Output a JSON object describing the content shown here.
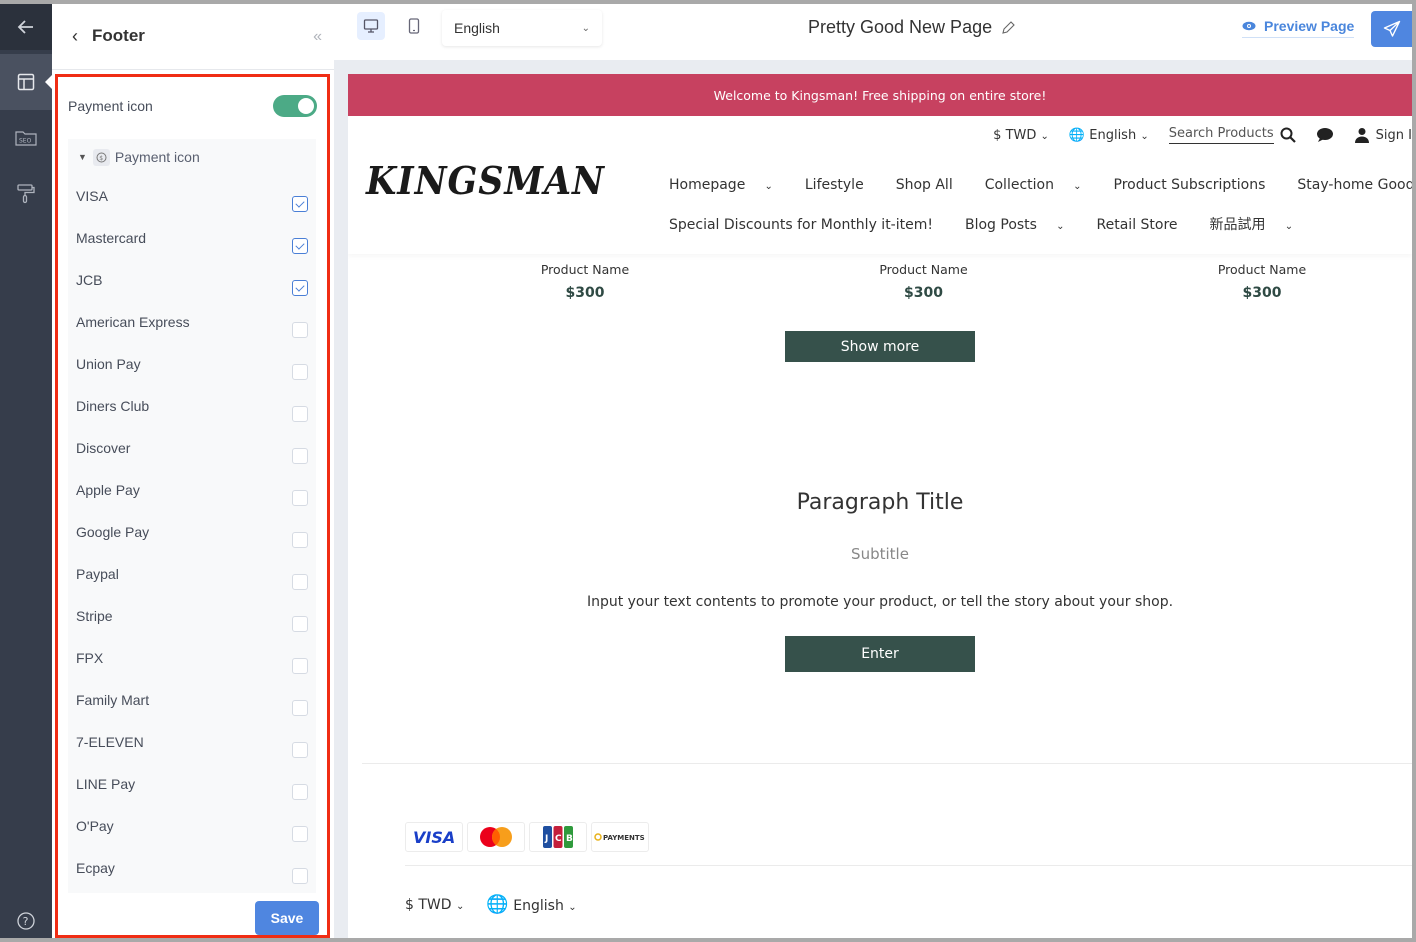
{
  "rail": {
    "icons": [
      "arrow-left-icon",
      "layout-icon",
      "seo-icon",
      "paint-roller-icon",
      "help-icon"
    ]
  },
  "panel": {
    "title": "Footer",
    "toggle_label": "Payment icon",
    "toggle_on": true,
    "group_label": "Payment icon",
    "options": [
      {
        "label": "VISA",
        "checked": true
      },
      {
        "label": "Mastercard",
        "checked": true
      },
      {
        "label": "JCB",
        "checked": true
      },
      {
        "label": "American Express",
        "checked": false
      },
      {
        "label": "Union Pay",
        "checked": false
      },
      {
        "label": "Diners Club",
        "checked": false
      },
      {
        "label": "Discover",
        "checked": false
      },
      {
        "label": "Apple Pay",
        "checked": false
      },
      {
        "label": "Google Pay",
        "checked": false
      },
      {
        "label": "Paypal",
        "checked": false
      },
      {
        "label": "Stripe",
        "checked": false
      },
      {
        "label": "FPX",
        "checked": false
      },
      {
        "label": "Family Mart",
        "checked": false
      },
      {
        "label": "7-ELEVEN",
        "checked": false
      },
      {
        "label": "LINE Pay",
        "checked": false
      },
      {
        "label": "O'Pay",
        "checked": false
      },
      {
        "label": "Ecpay",
        "checked": false
      }
    ],
    "save_label": "Save"
  },
  "topbar": {
    "language": "English",
    "page_title": "Pretty Good New Page",
    "preview_label": "Preview Page"
  },
  "site": {
    "announcement": "Welcome to Kingsman! Free shipping on entire store!",
    "currency": "$ TWD",
    "language": "English",
    "search_placeholder": "Search Products",
    "sign_in": "Sign I",
    "logo": "KINGSMAN",
    "nav": [
      "Homepage",
      "Lifestyle",
      "Shop All",
      "Collection",
      "Product Subscriptions",
      "Stay-home Goodies",
      "Special Discounts for Monthly it-item!",
      "Blog Posts",
      "Retail Store",
      "新品試用"
    ],
    "products": [
      {
        "name": "Product Name",
        "price": "$300"
      },
      {
        "name": "Product Name",
        "price": "$300"
      },
      {
        "name": "Product Name",
        "price": "$300"
      }
    ],
    "show_more": "Show more",
    "paragraph_title": "Paragraph Title",
    "subtitle": "Subtitle",
    "text": "Input your text contents to promote your product, or tell the story about your shop.",
    "enter": "Enter",
    "payment_icons": [
      "VISA",
      "Mastercard",
      "JCB",
      "PAYMENTS"
    ],
    "footer_currency": "$ TWD",
    "footer_language": "English"
  },
  "colors": {
    "accent": "#4f86e0",
    "announcement_bg": "#c74160",
    "button_dark": "#36514b",
    "toggle_on": "#4caa86",
    "highlight_border": "#f02d14"
  }
}
